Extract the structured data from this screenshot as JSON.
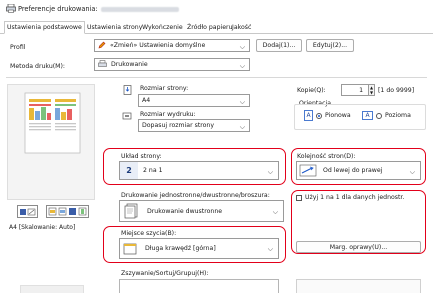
{
  "window": {
    "title": "Preferencje drukowania:"
  },
  "tabs": [
    {
      "label": "Ustawienia podstawowe",
      "active": true
    },
    {
      "label": "Ustawienia strony"
    },
    {
      "label": "Wykończenie"
    },
    {
      "label": "Źródło papieru"
    },
    {
      "label": "Jakość"
    }
  ],
  "profile": {
    "label": "Profil",
    "value": "«Zmień» Ustawienia domyślne",
    "add_label": "Dodaj(1)...",
    "edit_label": "Edytuj(2)..."
  },
  "print_method": {
    "label": "Metoda druku(M):",
    "value": "Drukowanie"
  },
  "page_size": {
    "label": "Rozmiar strony:",
    "value": "A4"
  },
  "output_size": {
    "label": "Rozmiar wydruku:",
    "value": "Dopasuj rozmiar strony"
  },
  "copies": {
    "label": "Kopie(Q):",
    "value": "1",
    "range": "[1 do 9999]"
  },
  "orientation": {
    "label": "Orientacja",
    "portrait_label": "Pionowa",
    "landscape_label": "Pozioma",
    "selected": "portrait"
  },
  "preview": {
    "caption": "A4 [Skalowanie: Auto]"
  },
  "page_layout": {
    "label": "Układ strony:",
    "value": "2 na 1",
    "icon_text": "2"
  },
  "page_order": {
    "label": "Kolejność stron(D):",
    "value": "Od lewej do prawej"
  },
  "duplex": {
    "label": "Drukowanie jednostronne/dwustronne/broszura:",
    "value": "Drukowanie dwustronne"
  },
  "use_2on1": {
    "label": "Użyj 1 na 1 dla danych jednostr.",
    "checked": false
  },
  "binding": {
    "label": "Miejsce szycia(B):",
    "value": "Długa krawędź [górna]"
  },
  "margin_button": {
    "label": "Marg. oprawy(U)..."
  },
  "staple": {
    "label": "Zszywanie/Sortuj/Grupuj(H):"
  },
  "colors": {
    "accent": "#1a56c8",
    "highlight": "#e2001a"
  }
}
